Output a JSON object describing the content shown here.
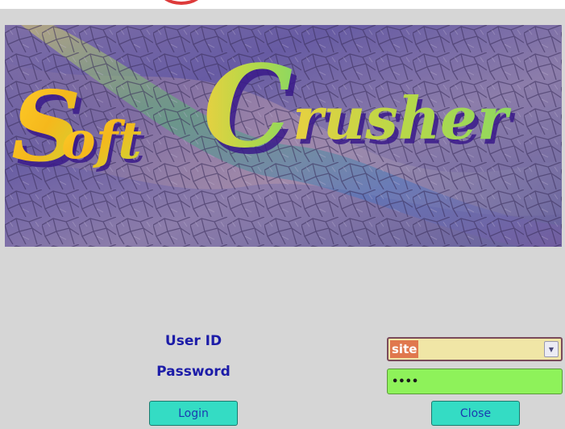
{
  "banner": {
    "logo_text": "SoftCrusher"
  },
  "form": {
    "userid_label": "User ID",
    "userid_value": "site",
    "password_label": "Password",
    "password_value": "••••"
  },
  "buttons": {
    "login_label": "Login",
    "close_label": "Close"
  },
  "colors": {
    "window_bg": "#d6d6d6",
    "label_text": "#1c1ca8",
    "combo_bg": "#f0e6a6",
    "selection_bg": "#e0784e",
    "password_bg": "#8ef25a",
    "button_bg": "#34dcc4",
    "button_text": "#1a3ab0"
  },
  "icons": {
    "combo_arrow": "chevron-down-icon"
  }
}
